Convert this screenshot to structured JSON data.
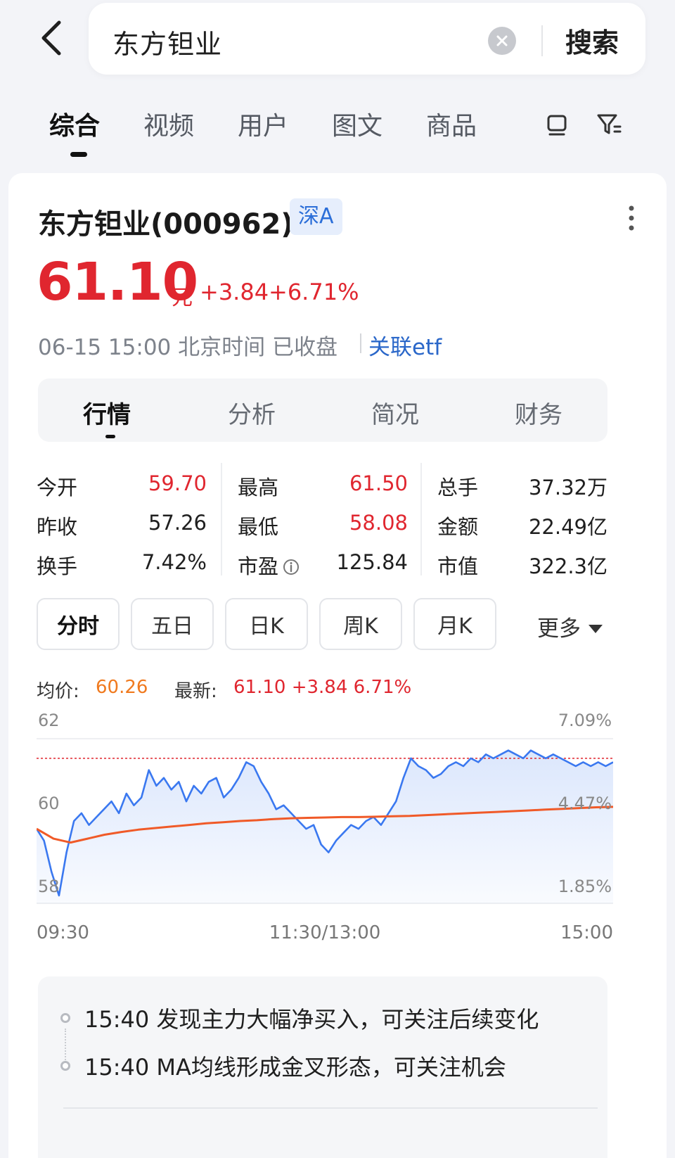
{
  "search": {
    "query": "东方钽业",
    "submit_label": "搜索"
  },
  "tabs": [
    {
      "label": "综合"
    },
    {
      "label": "视频"
    },
    {
      "label": "用户"
    },
    {
      "label": "图文"
    },
    {
      "label": "商品"
    }
  ],
  "stock": {
    "name": "东方钽业(000962)",
    "market": "深A",
    "price": "61.10",
    "unit": "元",
    "change": "+3.84",
    "change_pct": "+6.71%",
    "time_status": "06-15 15:00 北京时间 已收盘",
    "etf_link": "关联etf"
  },
  "sub_tabs": [
    {
      "label": "行情"
    },
    {
      "label": "分析"
    },
    {
      "label": "简况"
    },
    {
      "label": "财务"
    }
  ],
  "quote": [
    [
      {
        "label": "今开",
        "value": "59.70",
        "red": true
      },
      {
        "label": "最高",
        "value": "61.50",
        "red": true
      },
      {
        "label": "总手",
        "value": "37.32万",
        "red": false
      }
    ],
    [
      {
        "label": "昨收",
        "value": "57.26",
        "red": false
      },
      {
        "label": "最低",
        "value": "58.08",
        "red": true
      },
      {
        "label": "金额",
        "value": "22.49亿",
        "red": false
      }
    ],
    [
      {
        "label": "换手",
        "value": "7.42%",
        "red": false
      },
      {
        "label": "市盈",
        "value": "125.84",
        "red": false
      },
      {
        "label": "市值",
        "value": "322.3亿",
        "red": false
      }
    ]
  ],
  "periods": [
    {
      "label": "分时"
    },
    {
      "label": "五日"
    },
    {
      "label": "日K"
    },
    {
      "label": "周K"
    },
    {
      "label": "月K"
    }
  ],
  "more_label": "更多",
  "chart_info": {
    "avg_label": "均价:",
    "avg_value": "60.26",
    "latest_label": "最新:",
    "latest_value": "61.10 +3.84 6.71%"
  },
  "chart_data": {
    "type": "line",
    "y_left_ticks": [
      "62",
      "60",
      "58"
    ],
    "y_right_ticks": [
      "7.09%",
      "4.47%",
      "1.85%"
    ],
    "x_ticks": [
      "09:30",
      "11:30/13:00",
      "15:00"
    ],
    "ylim": [
      57.8,
      62.0
    ],
    "reference_high": 61.5,
    "series": [
      {
        "key": "price",
        "color": "#3a78f0",
        "values": [
          59.7,
          59.4,
          58.6,
          58.0,
          59.1,
          59.9,
          60.1,
          59.8,
          60.0,
          60.2,
          60.4,
          60.1,
          60.6,
          60.3,
          60.5,
          61.2,
          60.8,
          61.0,
          60.7,
          60.9,
          60.4,
          60.8,
          60.6,
          60.9,
          61.0,
          60.5,
          60.7,
          61.0,
          61.4,
          61.3,
          60.9,
          60.6,
          60.2,
          60.3,
          60.1,
          59.9,
          59.7,
          59.8,
          59.3,
          59.1,
          59.4,
          59.6,
          59.8,
          59.7,
          59.9,
          60.0,
          59.8,
          60.1,
          60.4,
          61.0,
          61.5,
          61.3,
          61.2,
          61.0,
          61.1,
          61.3,
          61.4,
          61.3,
          61.5,
          61.4,
          61.6,
          61.5,
          61.6,
          61.7,
          61.6,
          61.5,
          61.7,
          61.6,
          61.5,
          61.6,
          61.5,
          61.4,
          61.3,
          61.4,
          61.3,
          61.4,
          61.3,
          61.4
        ]
      },
      {
        "key": "average",
        "color": "#f05a28",
        "values": [
          59.7,
          59.45,
          59.35,
          59.45,
          59.55,
          59.62,
          59.68,
          59.72,
          59.76,
          59.8,
          59.84,
          59.87,
          59.9,
          59.92,
          59.95,
          59.97,
          59.98,
          59.99,
          60.0,
          60.0,
          60.01,
          60.02,
          60.03,
          60.05,
          60.07,
          60.09,
          60.11,
          60.13,
          60.15,
          60.17,
          60.19,
          60.21,
          60.23,
          60.25,
          60.26
        ]
      }
    ]
  },
  "alerts": [
    {
      "text": "15:40 发现主力大幅净买入，可关注后续变化"
    },
    {
      "text": "15:40 MA均线形成金叉形态，可关注机会"
    }
  ]
}
